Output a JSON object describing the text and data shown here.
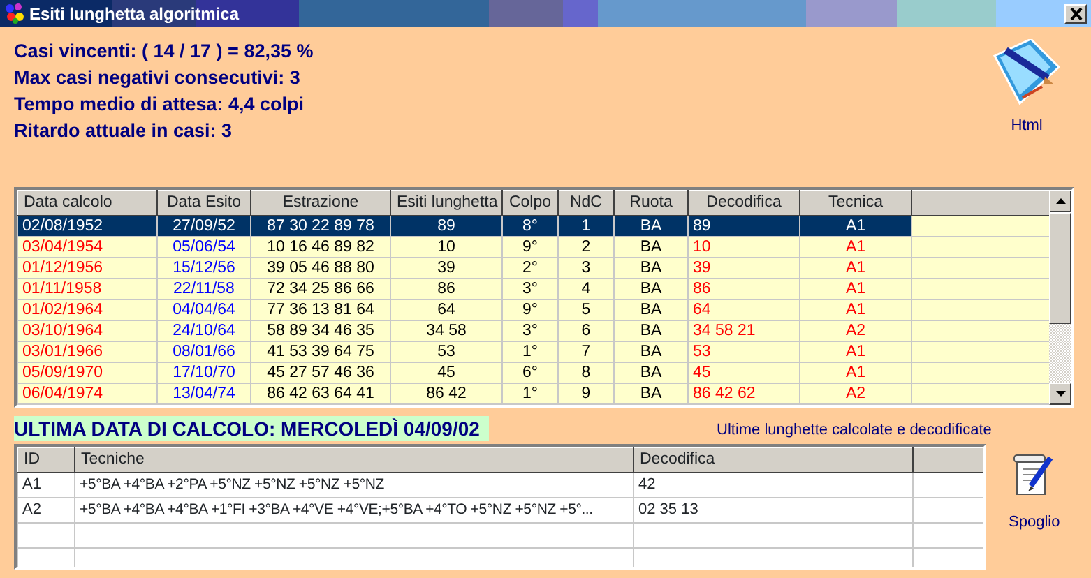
{
  "window": {
    "title": "Esiti lunghetta algoritmica"
  },
  "stats": [
    "Casi vincenti: ( 14 / 17 ) = 82,35 %",
    "Max casi negativi consecutivi: 3",
    "Tempo medio di attesa: 4,4 colpi",
    "Ritardo attuale in casi: 3"
  ],
  "html_button": {
    "label": "Html"
  },
  "results_table": {
    "columns": [
      "Data calcolo",
      "Data Esito",
      "Estrazione",
      "Esiti lunghetta",
      "Colpo",
      "NdC",
      "Ruota",
      "Decodifica",
      "Tecnica"
    ],
    "rows": [
      {
        "selected": true,
        "cells": [
          "02/08/1952",
          "27/09/52",
          "87 30 22 89 78",
          "89",
          "8°",
          "1",
          "BA",
          "89",
          "A1"
        ]
      },
      {
        "selected": false,
        "cells": [
          "03/04/1954",
          "05/06/54",
          "10 16 46 89 82",
          "10",
          "9°",
          "2",
          "BA",
          "10",
          "A1"
        ]
      },
      {
        "selected": false,
        "cells": [
          "01/12/1956",
          "15/12/56",
          "39 05 46 88 80",
          "39",
          "2°",
          "3",
          "BA",
          "39",
          "A1"
        ]
      },
      {
        "selected": false,
        "cells": [
          "01/11/1958",
          "22/11/58",
          "72 34 25 86 66",
          "86",
          "3°",
          "4",
          "BA",
          "86",
          "A1"
        ]
      },
      {
        "selected": false,
        "cells": [
          "01/02/1964",
          "04/04/64",
          "77 36 13 81 64",
          "64",
          "9°",
          "5",
          "BA",
          "64",
          "A1"
        ]
      },
      {
        "selected": false,
        "cells": [
          "03/10/1964",
          "24/10/64",
          "58 89 34 46 35",
          "34 58",
          "3°",
          "6",
          "BA",
          "34 58 21",
          "A2"
        ]
      },
      {
        "selected": false,
        "cells": [
          "03/01/1966",
          "08/01/66",
          "41 53 39 64 75",
          "53",
          "1°",
          "7",
          "BA",
          "53",
          "A1"
        ]
      },
      {
        "selected": false,
        "cells": [
          "05/09/1970",
          "17/10/70",
          "45 27 57 46 36",
          "45",
          "6°",
          "8",
          "BA",
          "45",
          "A1"
        ]
      },
      {
        "selected": false,
        "cells": [
          "06/04/1974",
          "13/04/74",
          "86 42 63 64 41",
          "86 42",
          "1°",
          "9",
          "BA",
          "86 42 62",
          "A2"
        ]
      }
    ]
  },
  "last_calc": {
    "title": "ULTIMA DATA DI CALCOLO: MERCOLEDÌ 04/09/02",
    "caption": "Ultime lunghette calcolate e decodificate"
  },
  "techniques_table": {
    "columns": [
      "ID",
      "Tecniche",
      "Decodifica"
    ],
    "rows": [
      {
        "cells": [
          "A1",
          "+5°BA +4°BA +2°PA +5°NZ +5°NZ +5°NZ +5°NZ",
          "42"
        ]
      },
      {
        "cells": [
          "A2",
          "+5°BA +4°BA +4°BA +1°FI +3°BA +4°VE +4°VE;+5°BA +4°TO +5°NZ +5°NZ +5°...",
          "02 35 13"
        ]
      }
    ]
  },
  "spoglio_button": {
    "label": "Spoglio"
  }
}
